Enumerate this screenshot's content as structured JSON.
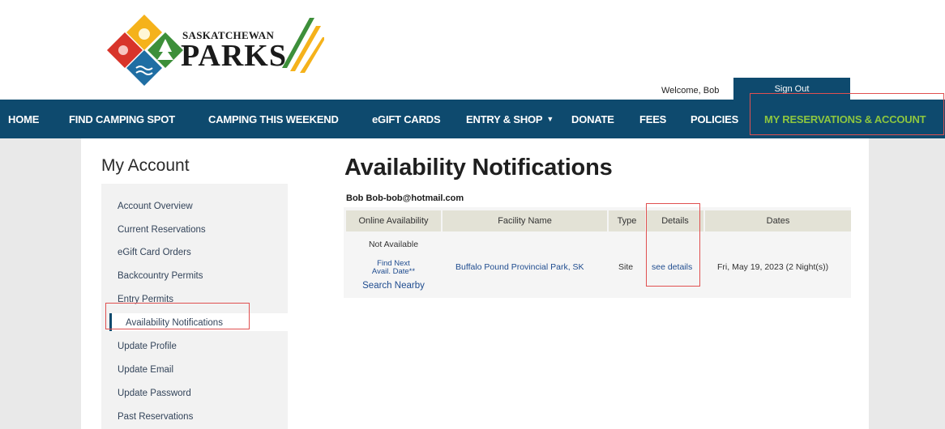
{
  "header": {
    "logo_top": "SASKATCHEWAN",
    "logo_main": "PARKS",
    "welcome": "Welcome, Bob",
    "signout": "Sign Out"
  },
  "nav": {
    "home": "HOME",
    "find_camping": "FIND CAMPING SPOT",
    "camping_weekend": "CAMPING THIS WEEKEND",
    "egift": "eGIFT CARDS",
    "entry_shop": "ENTRY & SHOP",
    "donate": "DONATE",
    "fees": "FEES",
    "policies": "POLICIES",
    "my_reservations": "MY RESERVATIONS & ACCOUNT",
    "active_color": "#8dc63f",
    "bar_color": "#0e4a6e"
  },
  "sidebar": {
    "title": "My Account",
    "items": [
      "Account Overview",
      "Current Reservations",
      "eGift Card Orders",
      "Backcountry Permits",
      "Entry Permits",
      "Availability Notifications",
      "Update Profile",
      "Update Email",
      "Update Password",
      "Past Reservations"
    ],
    "active_index": 5
  },
  "main": {
    "title": "Availability Notifications",
    "user": "Bob Bob-bob@hotmail.com",
    "table": {
      "headers": [
        "Online Availability",
        "Facility Name",
        "Type",
        "Details",
        "Dates"
      ],
      "row": {
        "availability": "Not Available",
        "find_next_1": "Find Next",
        "find_next_2": "Avail. Date**",
        "search_nearby": "Search Nearby",
        "facility": "Buffalo Pound Provincial Park, SK",
        "type": "Site",
        "details": "see details",
        "dates": "Fri, May 19, 2023 (2 Night(s))"
      }
    }
  },
  "colors": {
    "highlight_box": "#e05050"
  }
}
